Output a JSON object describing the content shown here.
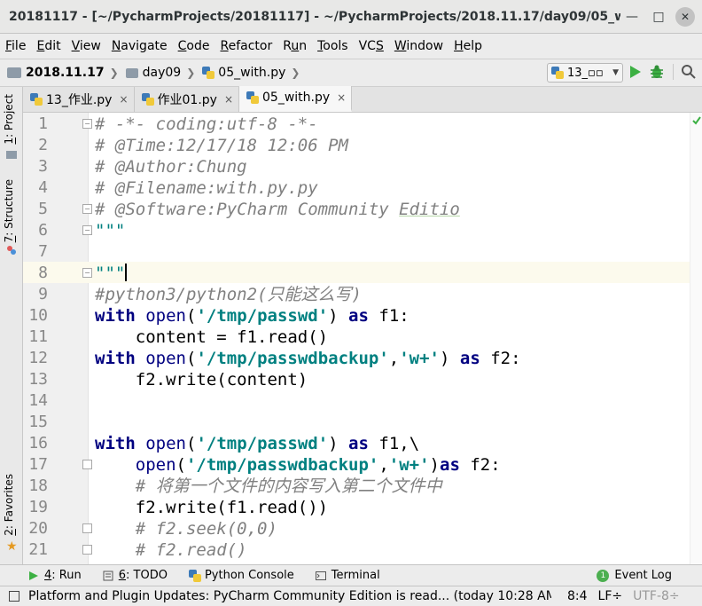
{
  "window": {
    "title": "20181117 - [~/PycharmProjects/20181117] - ~/PycharmProjects/2018.11.17/day09/05_w..."
  },
  "menu": [
    "File",
    "Edit",
    "View",
    "Navigate",
    "Code",
    "Refactor",
    "Run",
    "Tools",
    "VCS",
    "Window",
    "Help"
  ],
  "menu_mnemonics": [
    "F",
    "E",
    "V",
    "N",
    "C",
    "R",
    "u",
    "T",
    "S",
    "W",
    "H"
  ],
  "breadcrumb": {
    "project": "2018.11.17",
    "folder": "day09",
    "file": "05_with.py"
  },
  "run_config": {
    "name": "13_▫▫"
  },
  "left_tool_windows": [
    {
      "num": "1",
      "label": "Project"
    },
    {
      "num": "7",
      "label": "Structure"
    },
    {
      "num": "2",
      "label": "Favorites"
    }
  ],
  "tabs": [
    {
      "label": "13_作业.py",
      "active": false
    },
    {
      "label": "作业01.py",
      "active": false
    },
    {
      "label": "05_with.py",
      "active": true
    }
  ],
  "tab_close": "×",
  "code_lines": [
    {
      "n": "1",
      "text": "# -*- coding:utf-8 -*-"
    },
    {
      "n": "2",
      "text": "# @Time:12/17/18 12:06 PM"
    },
    {
      "n": "3",
      "text": "# @Author:Chung"
    },
    {
      "n": "4",
      "text": "# @Filename:with.py.py"
    },
    {
      "n": "5",
      "text": "# @Software:PyCharm Community Editio"
    },
    {
      "n": "6",
      "text": "\"\"\""
    },
    {
      "n": "7",
      "text": ""
    },
    {
      "n": "8",
      "text": "\"\"\""
    },
    {
      "n": "9",
      "text": "#python3/python2(只能这么写)"
    },
    {
      "n": "10",
      "text": "with open('/tmp/passwd') as f1:"
    },
    {
      "n": "11",
      "text": "    content = f1.read()"
    },
    {
      "n": "12",
      "text": "with open('/tmp/passwdbackup','w+') as f2:"
    },
    {
      "n": "13",
      "text": "    f2.write(content)"
    },
    {
      "n": "14",
      "text": ""
    },
    {
      "n": "15",
      "text": ""
    },
    {
      "n": "16",
      "text": "with open('/tmp/passwd') as f1,\\"
    },
    {
      "n": "17",
      "text": "    open('/tmp/passwdbackup','w+')as f2:"
    },
    {
      "n": "18",
      "text": "    # 将第一个文件的内容写入第二个文件中"
    },
    {
      "n": "19",
      "text": "    f2.write(f1.read())"
    },
    {
      "n": "20",
      "text": "    # f2.seek(0,0)"
    },
    {
      "n": "21",
      "text": "    # f2.read()"
    }
  ],
  "bottom_tools": [
    {
      "num": "4",
      "label": "Run"
    },
    {
      "num": "6",
      "label": "TODO"
    },
    {
      "num": "",
      "label": "Python Console"
    },
    {
      "num": "",
      "label": "Terminal"
    }
  ],
  "event_log": {
    "count": "1",
    "label": "Event Log"
  },
  "status": {
    "message": "Platform and Plugin Updates: PyCharm Community Edition is read... (today 10:28 AM)",
    "position": "8:4",
    "line_sep": "LF÷",
    "encoding": "UTF-8÷"
  },
  "colors": {
    "keyword": "#000080",
    "string": "#008080",
    "comment": "#808080",
    "caret_line": "#fcfaed",
    "run_green": "#3cb043"
  }
}
